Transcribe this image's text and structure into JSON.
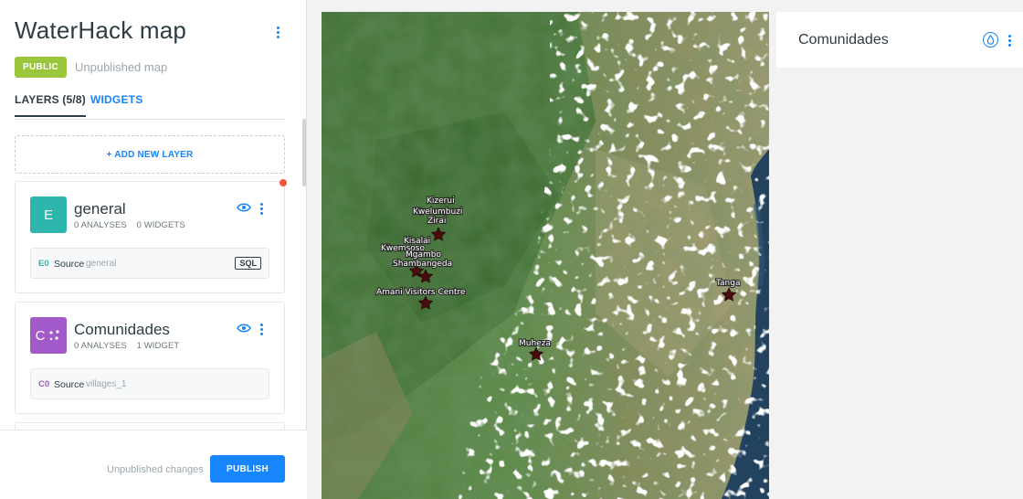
{
  "map": {
    "title": "WaterHack map",
    "privacy_badge": "PUBLIC",
    "publish_status": "Unpublished map"
  },
  "tabs": [
    {
      "label": "LAYERS (5/8)",
      "active": true
    },
    {
      "label": "WIDGETS",
      "active": false
    }
  ],
  "add_layer_label": "+ ADD NEW LAYER",
  "layers": [
    {
      "letter": "E",
      "color": "#2eb6ad",
      "name": "general",
      "analyses": "0 ANALYSES",
      "widgets": "0 WIDGETS",
      "source_id": "E0",
      "source_label": "Source",
      "source_name": "general",
      "tag": "SQL",
      "visibility_icon": "eye-icon"
    },
    {
      "letter": "C",
      "color": "#a259c9",
      "name": "Comunidades",
      "analyses": "0 ANALYSES",
      "widgets": "1 WIDGET",
      "source_id": "C0",
      "source_label": "Source",
      "source_name": "villages_1",
      "visibility_icon": "eye-icon"
    }
  ],
  "footer": {
    "status": "Unpublished changes",
    "publish_label": "PUBLISH"
  },
  "widget": {
    "title": "Comunidades",
    "icon": "droplet-icon"
  },
  "map_labels": [
    {
      "text": "Kizerui"
    },
    {
      "text": "Kwelumbuzi"
    },
    {
      "text": "Zirai"
    },
    {
      "text": "Kisalai"
    },
    {
      "text": "Kwemsoso"
    },
    {
      "text": "Mgambo"
    },
    {
      "text": "Shambangeda"
    },
    {
      "text": "Amani Visitors Centre"
    },
    {
      "text": "Muheza"
    },
    {
      "text": "Tanga"
    }
  ],
  "colors": {
    "accent": "#1785fb",
    "public_badge": "#9bc63b",
    "notification": "#f2573d",
    "marker": "#4a0d0d"
  }
}
